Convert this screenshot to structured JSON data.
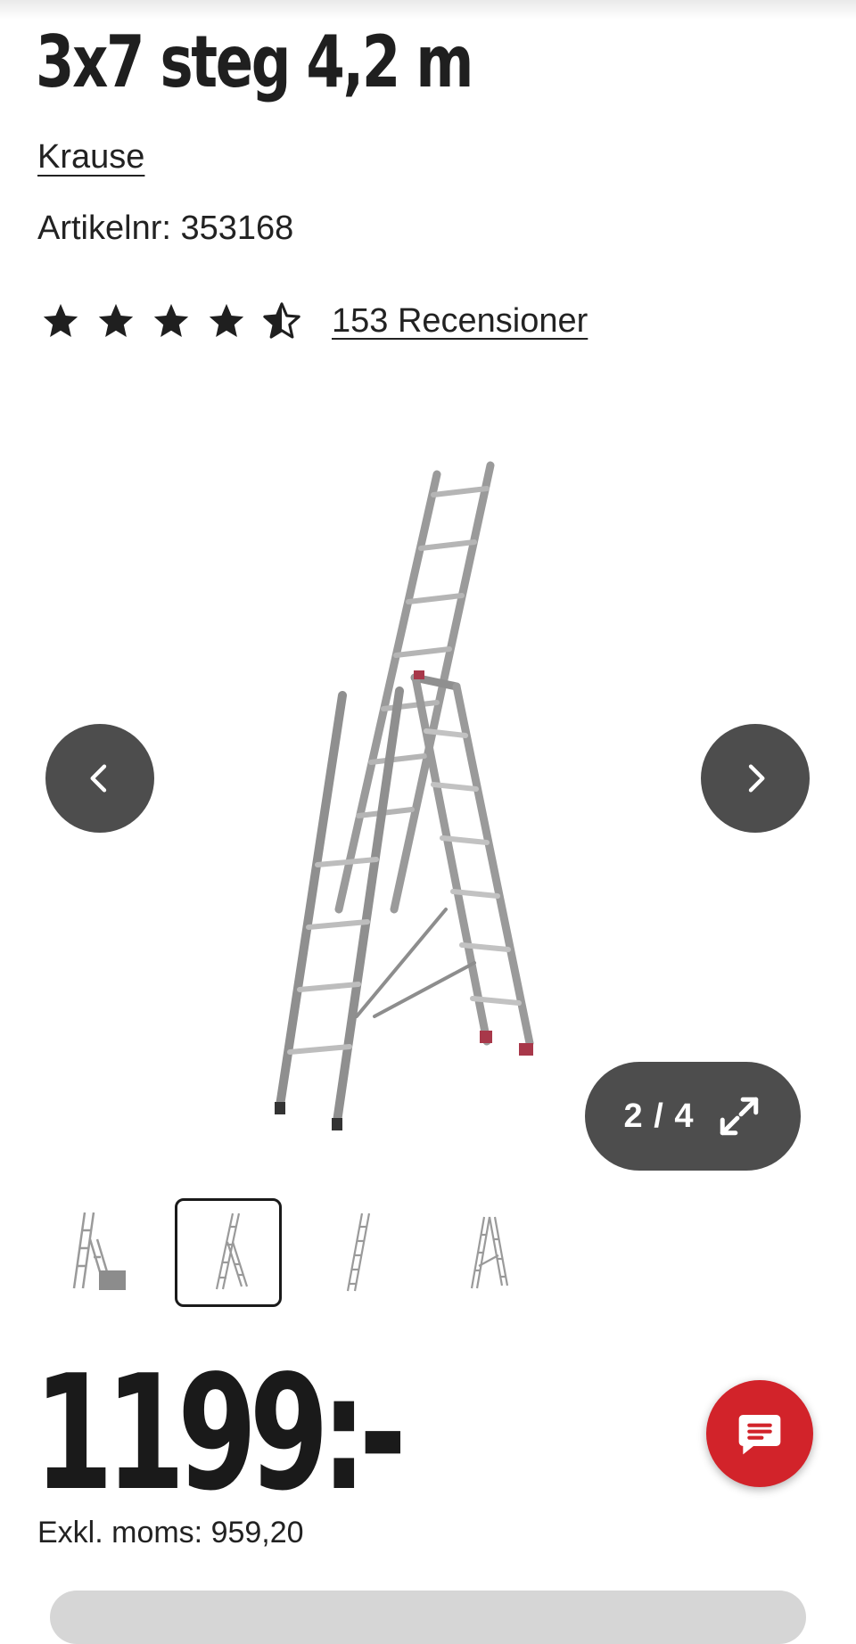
{
  "product": {
    "title": "3x7 steg 4,2 m",
    "brand": "Krause",
    "article_number": "Artikelnr: 353168",
    "rating": {
      "value": 4.5,
      "max": 5
    },
    "reviews_label": "153 Recensioner"
  },
  "gallery": {
    "counter": "2 / 4",
    "current_index": 2,
    "total": 4,
    "prev_icon": "chevron-left-icon",
    "next_icon": "chevron-right-icon",
    "expand_icon": "expand-icon",
    "thumbnails": [
      {
        "name": "thumb-ladder-with-box"
      },
      {
        "name": "thumb-ladder-combined",
        "active": true
      },
      {
        "name": "thumb-ladder-straight"
      },
      {
        "name": "thumb-ladder-a-frame"
      }
    ]
  },
  "pricing": {
    "price": "1199:-",
    "excl_vat": "Exkl. moms: 959,20"
  },
  "chat": {
    "icon": "chat-icon"
  },
  "colors": {
    "accent": "#d2232a",
    "nav_button": "#4d4d4d",
    "text": "#222222"
  }
}
